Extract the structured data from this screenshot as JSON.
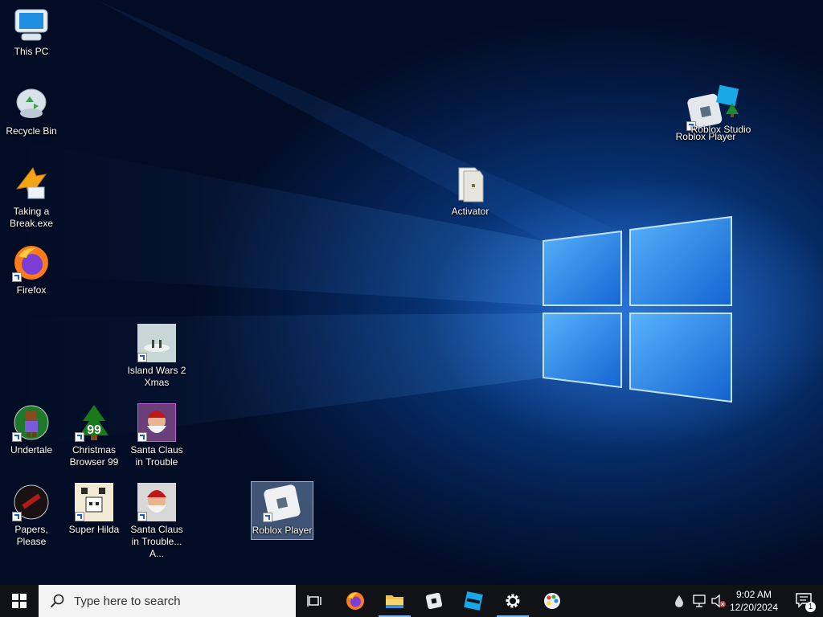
{
  "desktop": {
    "icons": {
      "this_pc": "This PC",
      "recycle_bin": "Recycle Bin",
      "taking_break": "Taking a Break.exe",
      "firefox": "Firefox",
      "island_wars": "Island Wars 2 Xmas",
      "undertale": "Undertale",
      "christmas_browser": "Christmas Browser 99",
      "santa1": "Santa Claus in Trouble",
      "papers_please": "Papers, Please",
      "super_hilda": "Super Hilda",
      "santa2": "Santa Claus in Trouble... A...",
      "roblox_player_selected": "Roblox Player",
      "activator": "Activator",
      "roblox_studio": "Roblox Studio",
      "roblox_player_overlap": "Roblox Player",
      "christmas_browser_badge": "99"
    }
  },
  "taskbar": {
    "search_placeholder": "Type here to search",
    "clock_time": "9:02 AM",
    "clock_date": "12/20/2024",
    "notification_count": "1"
  },
  "colors": {
    "taskbar_bg": "#101216",
    "accent": "#0078d7",
    "active_indicator": "#7cb4ef"
  }
}
